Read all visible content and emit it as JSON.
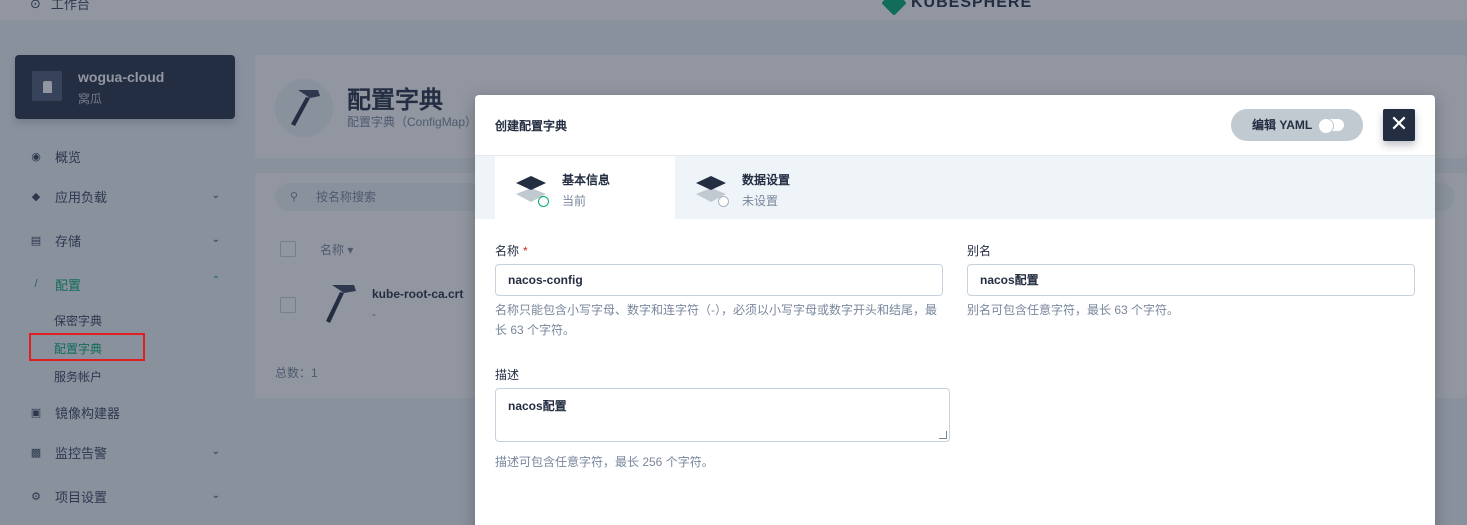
{
  "topbar": {
    "workbench": "工作台",
    "logo_text": "KUBESPHERE"
  },
  "workspace": {
    "name": "wogua-cloud",
    "alias": "窝瓜"
  },
  "sidebar": {
    "items": [
      {
        "label": "概览"
      },
      {
        "label": "应用负载"
      },
      {
        "label": "存储"
      },
      {
        "label": "配置"
      },
      {
        "label": "镜像构建器"
      },
      {
        "label": "监控告警"
      },
      {
        "label": "项目设置"
      }
    ],
    "config_sub": [
      {
        "label": "保密字典"
      },
      {
        "label": "配置字典"
      },
      {
        "label": "服务帐户"
      }
    ]
  },
  "page": {
    "title": "配置字典",
    "description": "配置字典（ConfigMap）",
    "search_placeholder": "按名称搜索",
    "col_name": "名称",
    "rows": [
      {
        "name": "kube-root-ca.crt",
        "sub": "-"
      }
    ],
    "total": "总数：1"
  },
  "modal": {
    "title": "创建配置字典",
    "yaml_label": "编辑 YAML",
    "steps": [
      {
        "label": "基本信息",
        "status": "当前"
      },
      {
        "label": "数据设置",
        "status": "未设置"
      }
    ],
    "form": {
      "name_label": "名称",
      "name_required": "*",
      "name_value": "nacos-config",
      "name_help": "名称只能包含小写字母、数字和连字符（-），必须以小写字母或数字开头和结尾，最长 63 个字符。",
      "alias_label": "别名",
      "alias_value": "nacos配置",
      "alias_help": "别名可包含任意字符，最长 63 个字符。",
      "desc_label": "描述",
      "desc_value": "nacos配置",
      "desc_help": "描述可包含任意字符，最长 256 个字符。"
    }
  },
  "colors": {
    "accent": "#00aa72",
    "dark": "#242e42",
    "highlight": "#e02020"
  }
}
